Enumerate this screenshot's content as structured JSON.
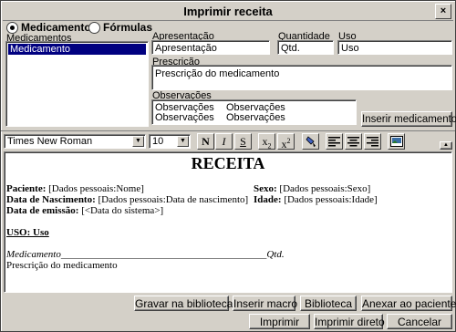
{
  "window": {
    "title": "Imprimir receita",
    "close_glyph": "×"
  },
  "tabs": {
    "option1": "Medicamentos",
    "option2": "Fórmulas",
    "selected": "Medicamentos"
  },
  "medicamentos": {
    "label": "Medicamentos",
    "items": [
      "Medicamento"
    ]
  },
  "apresentacao": {
    "label": "Apresentação",
    "value": "Apresentação"
  },
  "quantidade": {
    "label": "Quantidade",
    "value": "Qtd."
  },
  "uso": {
    "label": "Uso",
    "value": "Uso"
  },
  "prescricao": {
    "label": "Prescrição",
    "value": "Prescrição do medicamento"
  },
  "observacoes": {
    "label": "Observações",
    "cells": [
      "Observações",
      "Observações",
      "Observações",
      "Observações"
    ]
  },
  "buttons": {
    "inserir_medicamento": "Inserir medicamento",
    "gravar": "Gravar na biblioteca",
    "inserir_macro": "Inserir macro",
    "biblioteca": "Biblioteca",
    "anexar": "Anexar ao paciente",
    "imprimir": "Imprimir",
    "imprimir_direto": "Imprimir direto",
    "cancelar": "Cancelar"
  },
  "toolbar": {
    "font": "Times New Roman",
    "size": "10",
    "bold": "N",
    "italic": "I",
    "underline": "S",
    "subscript": "x",
    "subscript_mark": "2",
    "superscript": "x",
    "superscript_mark": "2",
    "icons": [
      "paint-icon",
      "align-left-icon",
      "align-center-icon",
      "align-right-icon",
      "image-icon",
      "collapse-arrow-icon"
    ]
  },
  "document": {
    "title": "RECEITA",
    "paciente_label": "Paciente:",
    "paciente_value": "[Dados pessoais:Nome]",
    "sexo_label": "Sexo:",
    "sexo_value": "[Dados pessoais:Sexo]",
    "nasc_label": "Data de Nascimento:",
    "nasc_value": "[Dados pessoais:Data de nascimento]",
    "idade_label": "Idade:",
    "idade_value": "[Dados pessoais:Idade]",
    "emissao_label": "Data de emissão:",
    "emissao_value": "[<Data do sistema>]",
    "uso_heading": "USO: Uso",
    "med_line": "Medicamento_________________________________________Qtd.",
    "prescricao_line": "Prescrição do medicamento"
  }
}
